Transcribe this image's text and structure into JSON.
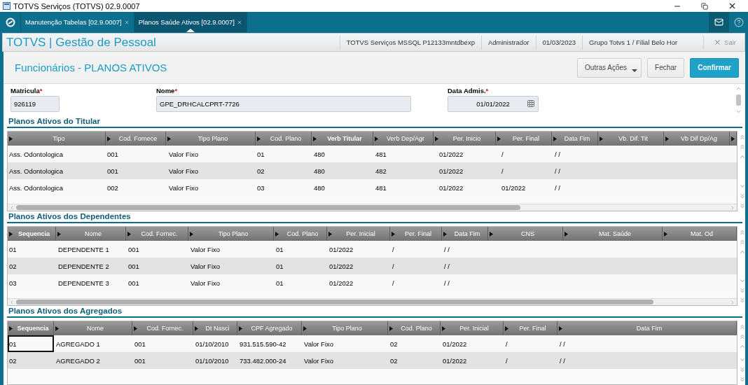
{
  "window": {
    "title": "TOTVS Serviços (TOTVS) 02.9.0007"
  },
  "tabs": [
    {
      "label": "Manutenção Tabelas [02.9.0007]",
      "selected": false
    },
    {
      "label": "Planos Saúde Ativos [02.9.0007]",
      "selected": true
    }
  ],
  "header": {
    "brand": "TOTVS | Gestão de Pessoal",
    "info": [
      "TOTVS Serviços MSSQL P12133mntdbexp",
      "Administrador",
      "01/03/2023",
      "Grupo Totvs 1 / Filial Belo Hor"
    ],
    "exit": "Sair"
  },
  "page": {
    "title": "Funcionários - PLANOS ATIVOS",
    "buttons": [
      {
        "label": "Outras Ações",
        "kind": "menu"
      },
      {
        "label": "Fechar",
        "kind": "default"
      },
      {
        "label": "Confirmar",
        "kind": "primary"
      }
    ]
  },
  "fields": [
    {
      "label": "Matricula",
      "required_mark": "*",
      "value": "926119",
      "kind": "text"
    },
    {
      "label": "Nome",
      "required_mark": "*",
      "value": "GPE_DRHCALCPRT-7726",
      "kind": "text"
    },
    {
      "label": "Data Admis.",
      "required_mark": "*",
      "value": "01/01/2022",
      "kind": "date"
    }
  ],
  "tables": [
    {
      "title": "Planos Ativos do Titular",
      "columns": [
        {
          "label": "Tipo",
          "bold": false
        },
        {
          "label": "Cod. Fornece",
          "bold": false
        },
        {
          "label": "Tipo Plano",
          "bold": false
        },
        {
          "label": "Cod. Plano",
          "bold": false
        },
        {
          "label": "Verb Titular",
          "bold": true
        },
        {
          "label": "Verb Dep/Agr",
          "bold": false
        },
        {
          "label": "Per. Inicio",
          "bold": false
        },
        {
          "label": "Per. Final",
          "bold": false
        },
        {
          "label": "Data Fim",
          "bold": false
        },
        {
          "label": "Vb. Dif. Tit",
          "bold": false
        },
        {
          "label": "Vb Dif Dp/Ag",
          "bold": false
        }
      ],
      "rows": [
        {
          "selected": false,
          "cells": [
            "Ass. Odontologica",
            "001",
            "Valor Fixo",
            "01",
            "480",
            "481",
            "01/2022",
            "/",
            "/ /"
          ]
        },
        {
          "selected": false,
          "cells": [
            "Ass. Odontologica",
            "001",
            "Valor Fixo",
            "02",
            "480",
            "482",
            "01/2022",
            "/",
            "/ /"
          ]
        },
        {
          "selected": false,
          "cells": [
            "Ass. Odontologica",
            "002",
            "Valor Fixo",
            "03",
            "480",
            "481",
            "01/2022",
            "01/2022",
            "/ /"
          ]
        }
      ]
    },
    {
      "title": "Planos Ativos dos Dependentes",
      "columns": [
        {
          "label": "Sequencia",
          "bold": true
        },
        {
          "label": "Nome",
          "bold": false
        },
        {
          "label": "Cod. Fornec.",
          "bold": false
        },
        {
          "label": "Tipo Plano",
          "bold": false
        },
        {
          "label": "Cod. Plano",
          "bold": false
        },
        {
          "label": "Per. Inicial",
          "bold": false
        },
        {
          "label": "Per. Final",
          "bold": false
        },
        {
          "label": "Data Fim",
          "bold": false
        },
        {
          "label": "CNS",
          "bold": false
        },
        {
          "label": "Mat. Saúde",
          "bold": false
        },
        {
          "label": "Mat. Od",
          "bold": false
        }
      ],
      "rows": [
        {
          "selected": false,
          "cells": [
            "01",
            "DEPENDENTE 1",
            "001",
            "Valor Fixo",
            "01",
            "01/2022",
            "/",
            "/ /"
          ]
        },
        {
          "selected": false,
          "cells": [
            "02",
            "DEPENDENTE 2",
            "001",
            "Valor Fixo",
            "01",
            "01/2022",
            "/",
            "/ /"
          ]
        },
        {
          "selected": false,
          "cells": [
            "03",
            "DEPENDENTE 3",
            "001",
            "Valor Fixo",
            "01",
            "01/2022",
            "/",
            "/ /"
          ]
        }
      ]
    },
    {
      "title": "Planos Ativos dos Agregados",
      "columns": [
        {
          "label": "Sequencia",
          "bold": true
        },
        {
          "label": "Nome",
          "bold": false
        },
        {
          "label": "Cod. Fornec.",
          "bold": false
        },
        {
          "label": "Dt Nasci",
          "bold": false
        },
        {
          "label": "CPF Agregado",
          "bold": false
        },
        {
          "label": "Tipo Plano",
          "bold": false
        },
        {
          "label": "Cod. Plano",
          "bold": false
        },
        {
          "label": "Per. Inicial",
          "bold": false
        },
        {
          "label": "Per. Final",
          "bold": false
        },
        {
          "label": "Data Fim",
          "bold": false
        }
      ],
      "rows": [
        {
          "selected": true,
          "cells": [
            "01",
            "AGREGADO 1",
            "001",
            "01/10/2010",
            "931.515.590-42",
            "Valor Fixo",
            "02",
            "01/2022",
            "/",
            "/ /"
          ]
        },
        {
          "selected": false,
          "cells": [
            "02",
            "AGREGADO 2",
            "001",
            "01/10/2010",
            "733.482.000-24",
            "Valor Fixo",
            "02",
            "01/2022",
            "/",
            "/ /"
          ]
        }
      ]
    }
  ]
}
